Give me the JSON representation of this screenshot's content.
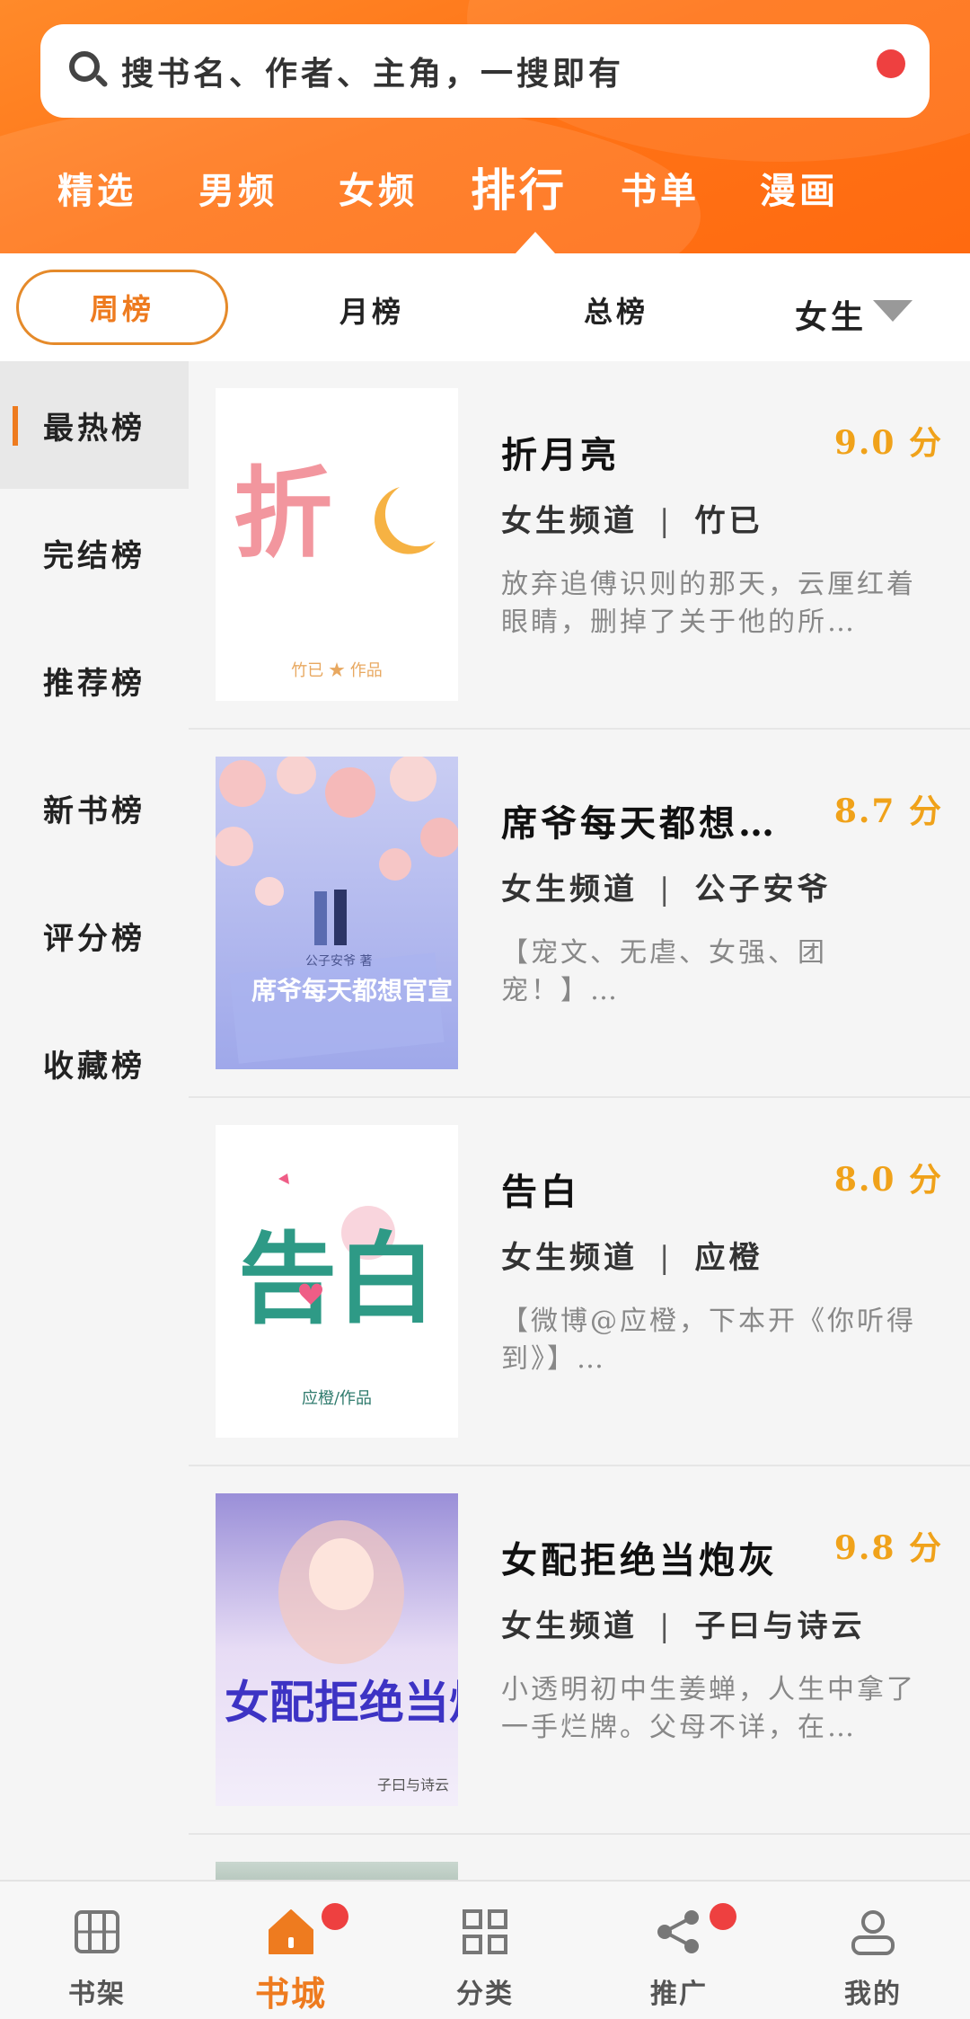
{
  "search": {
    "placeholder": "搜书名、作者、主角，一搜即有"
  },
  "top_tabs": [
    {
      "label": "精选"
    },
    {
      "label": "男频"
    },
    {
      "label": "女频"
    },
    {
      "label": "排行"
    },
    {
      "label": "书单"
    },
    {
      "label": "漫画"
    }
  ],
  "top_tabs_active": "排行",
  "sub_tabs": [
    {
      "label": "周榜"
    },
    {
      "label": "月榜"
    },
    {
      "label": "总榜"
    }
  ],
  "sub_tabs_active": "周榜",
  "gender_filter": "女生",
  "sidebar": {
    "items": [
      {
        "label": "最热榜"
      },
      {
        "label": "完结榜"
      },
      {
        "label": "推荐榜"
      },
      {
        "label": "新书榜"
      },
      {
        "label": "评分榜"
      },
      {
        "label": "收藏榜"
      }
    ],
    "active": "最热榜"
  },
  "books": [
    {
      "title": "折月亮",
      "score": "9.0 分",
      "channel": "女生频道",
      "author": "竹已",
      "desc": "放弃追傅识则的那天，云厘红着眼睛，删掉了关于他的所…",
      "cover_text": "折",
      "cover_credit": "竹已 ★ 作品"
    },
    {
      "title": "席爷每天都想…",
      "score": "8.7 分",
      "channel": "女生频道",
      "author": "公子安爷",
      "desc": "【宠文、无虐、女强、团宠！】…",
      "cover_text": "席爷每天都想官宣",
      "cover_credit": "公子安爷 著"
    },
    {
      "title": "告白",
      "score": "8.0 分",
      "channel": "女生频道",
      "author": "应橙",
      "desc": "【微博@应橙，下本开《你听得到》】…",
      "cover_text": "告白",
      "cover_credit": "应橙/作品"
    },
    {
      "title": "女配拒绝当炮灰",
      "score": "9.8 分",
      "channel": "女生频道",
      "author": "子曰与诗云",
      "desc": "小透明初中生姜蝉，人生中拿了一手烂牌。父母不详，在…",
      "cover_text": "女配拒绝当炮灰",
      "cover_credit": "子曰与诗云"
    }
  ],
  "bottom_nav": [
    {
      "label": "书架",
      "icon": "bookshelf-icon"
    },
    {
      "label": "书城",
      "icon": "bookstore-icon"
    },
    {
      "label": "分类",
      "icon": "category-icon"
    },
    {
      "label": "推广",
      "icon": "share-icon"
    },
    {
      "label": "我的",
      "icon": "profile-icon"
    }
  ],
  "bottom_nav_active": "书城",
  "colors": {
    "accent": "#ee7b1f",
    "header": "#ff7417",
    "score": "#f0a21a",
    "badge": "#ee4040"
  }
}
